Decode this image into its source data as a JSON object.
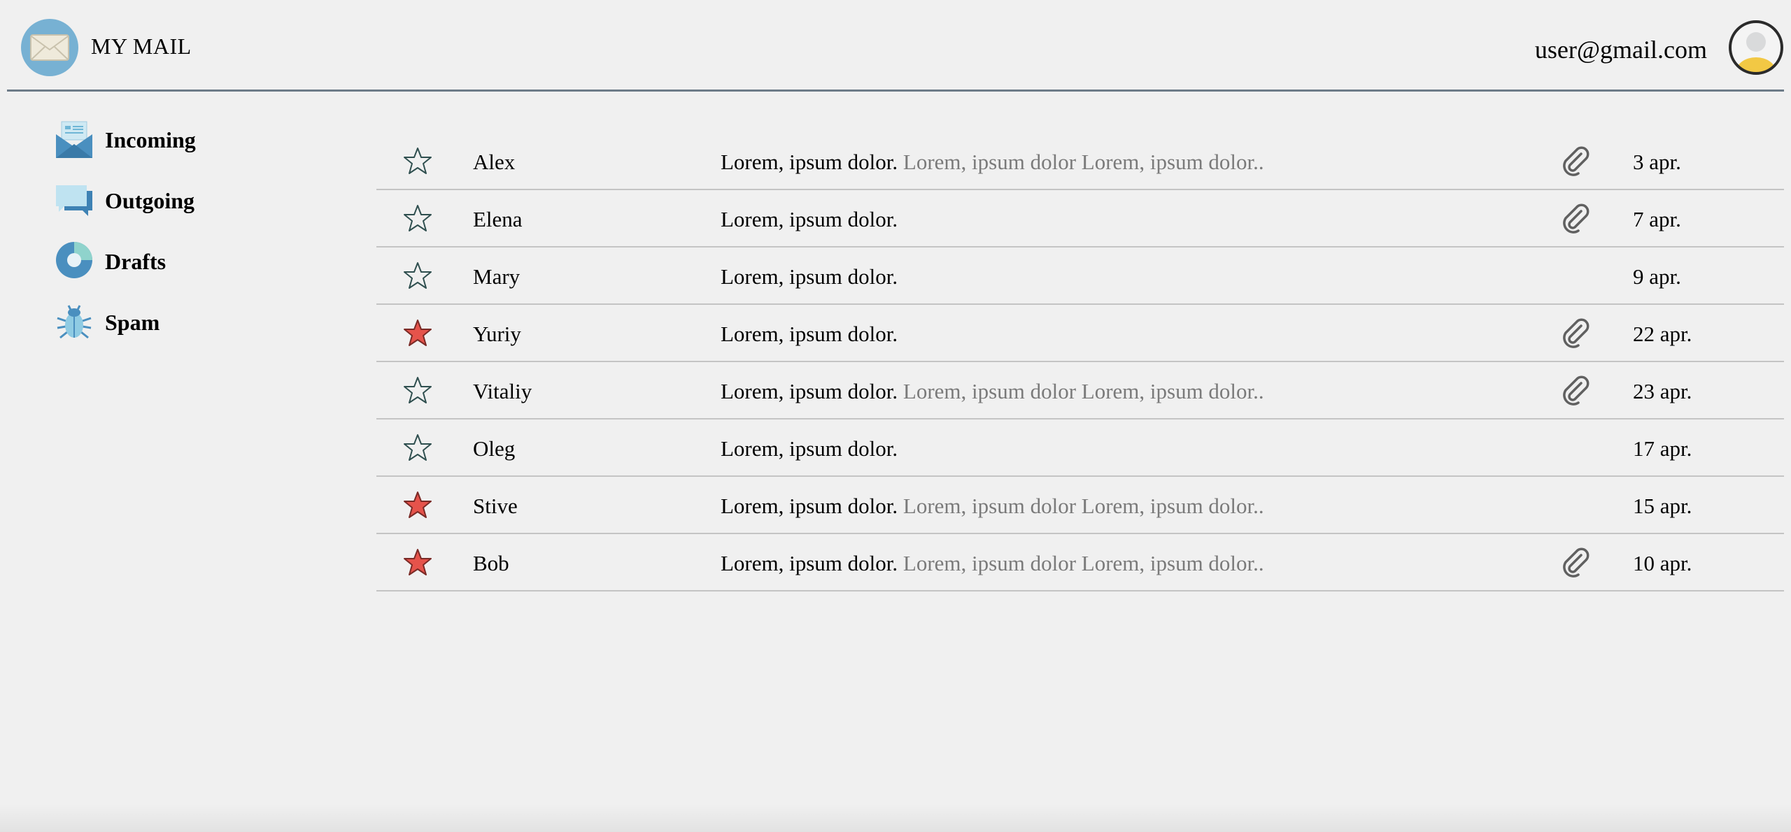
{
  "app": {
    "title": "MY MAIL",
    "logo_icon": "envelope-icon"
  },
  "user": {
    "email": "user@gmail.com",
    "avatar_icon": "user-avatar-icon"
  },
  "colors": {
    "accent": "#77b1d3",
    "star_active": "#e5534b",
    "divider": "#6d7b88"
  },
  "sidebar": {
    "items": [
      {
        "label": "Incoming",
        "icon": "inbox-icon"
      },
      {
        "label": "Outgoing",
        "icon": "outgoing-icon"
      },
      {
        "label": "Drafts",
        "icon": "drafts-icon"
      },
      {
        "label": "Spam",
        "icon": "spam-bug-icon"
      }
    ]
  },
  "mails": [
    {
      "sender": "Alex",
      "subject": "Lorem, ipsum dolor.",
      "preview": " Lorem, ipsum dolor Lorem, ipsum dolor..",
      "starred": false,
      "attachment": true,
      "date": "3 apr."
    },
    {
      "sender": "Elena",
      "subject": "Lorem, ipsum dolor.",
      "preview": "",
      "starred": false,
      "attachment": true,
      "date": "7 apr."
    },
    {
      "sender": "Mary",
      "subject": "Lorem, ipsum dolor.",
      "preview": "",
      "starred": false,
      "attachment": false,
      "date": "9 apr."
    },
    {
      "sender": "Yuriy",
      "subject": "Lorem, ipsum dolor.",
      "preview": "",
      "starred": true,
      "attachment": true,
      "date": "22 apr."
    },
    {
      "sender": "Vitaliy",
      "subject": "Lorem, ipsum dolor.",
      "preview": " Lorem, ipsum dolor Lorem, ipsum dolor..",
      "starred": false,
      "attachment": true,
      "date": "23 apr."
    },
    {
      "sender": "Oleg",
      "subject": "Lorem, ipsum dolor.",
      "preview": "",
      "starred": false,
      "attachment": false,
      "date": "17 apr."
    },
    {
      "sender": "Stive",
      "subject": "Lorem, ipsum dolor.",
      "preview": " Lorem, ipsum dolor Lorem, ipsum dolor..",
      "starred": true,
      "attachment": false,
      "date": "15 apr."
    },
    {
      "sender": "Bob",
      "subject": "Lorem, ipsum dolor.",
      "preview": " Lorem, ipsum dolor Lorem, ipsum dolor..",
      "starred": true,
      "attachment": true,
      "date": "10 apr."
    }
  ]
}
